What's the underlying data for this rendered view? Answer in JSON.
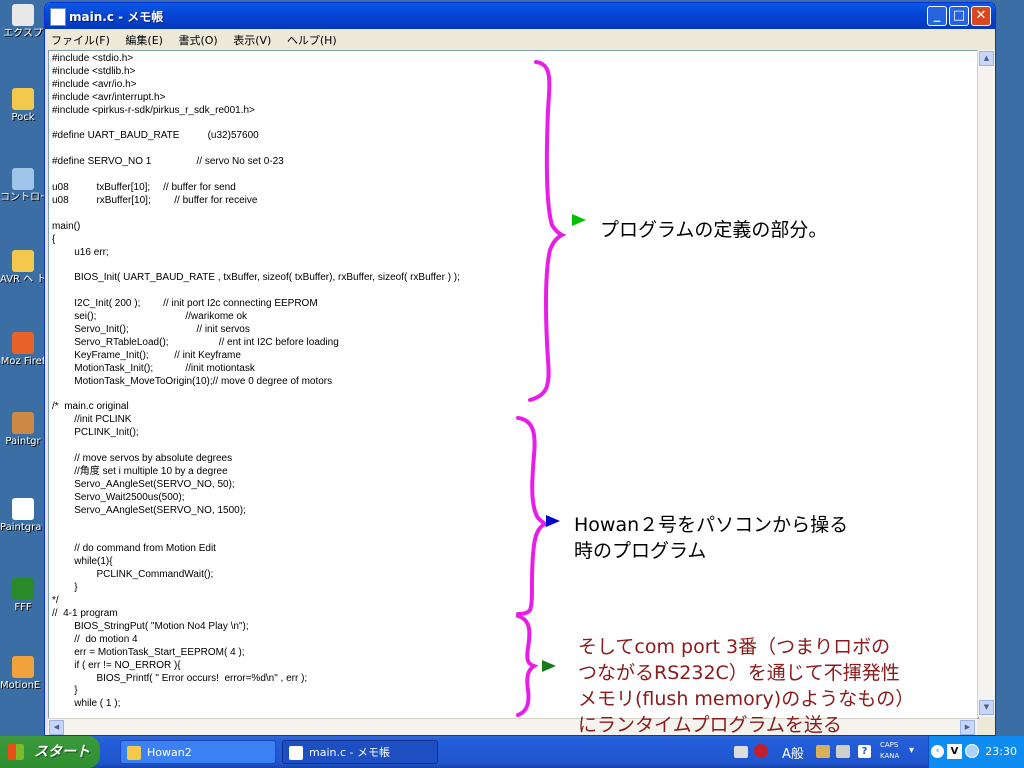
{
  "desktop": {
    "icons": [
      {
        "label": "エクスプ",
        "icon": "explorer-icon",
        "color": "#e8e8e8"
      },
      {
        "label": "Pock",
        "icon": "pocket-folder-icon",
        "color": "#f2c94c"
      },
      {
        "label": "コントロー ネ",
        "icon": "control-panel-icon",
        "color": "#9ec5e8"
      },
      {
        "label": "AVR ヘ トカ",
        "icon": "avr-folder-icon",
        "color": "#f2c94c"
      },
      {
        "label": "Moz Firef",
        "icon": "firefox-icon",
        "color": "#e8622a"
      },
      {
        "label": "Paintgr",
        "icon": "paint-icon",
        "color": "#cc8844"
      },
      {
        "label": "Paintgra マニュ",
        "icon": "manual-icon",
        "color": "#ffffff"
      },
      {
        "label": "FFF",
        "icon": "fff-icon",
        "color": "#2a8a2a"
      },
      {
        "label": "MotionE へのショ",
        "icon": "motion-editor-icon",
        "color": "#f2a23c"
      }
    ]
  },
  "window": {
    "title": "main.c - メモ帳",
    "controls": {
      "minimize": "_",
      "maximize": "□",
      "close": "✕"
    },
    "menu": [
      "ファイル(F)",
      "編集(E)",
      "書式(O)",
      "表示(V)",
      "ヘルプ(H)"
    ],
    "code": "#include <stdio.h>\n#include <stdlib.h>\n#include <avr/io.h>\n#include <avr/interrupt.h>\n#include <pirkus-r-sdk/pirkus_r_sdk_re001.h>\n\n#define UART_BAUD_RATE\t\t\t(u32)57600\n\n#define SERVO_NO 1\t\t\t\t// servo No set 0-23\n\nu08\t\t\ttxBuffer[10];\t\t// buffer for send\nu08\t\t\trxBuffer[10];\t\t// buffer for receive\n\nmain()\n{\n\t\tu16 err;\n\n\t\tBIOS_Init( UART_BAUD_RATE , txBuffer, sizeof( txBuffer), rxBuffer, sizeof( rxBuffer ) );\n\n\t\tI2C_Init( 200 );\t\t// init port I2c connecting EEPROM\n\t\tsei();\t\t\t\t\t\t\t\t//warikome ok\n\t\tServo_Init();\t\t\t\t\t\t// init servos\n\t\tServo_RTableLoad();\t\t\t\t\t// ent int I2C before loading\n\t\tKeyFrame_Init();\t\t\t// init Keyframe\n\t\tMotionTask_Init();\t\t\t//init motiontask\n\t\tMotionTask_MoveToOrigin(10);// move 0 degree of motors\n\n/*  main.c original\n\t\t//init PCLINK\n\t\tPCLINK_Init();\n\n\t\t// move servos by absolute degrees\n\t\t//角度 set i multiple 10 by a degree\n\t\tServo_AAngleSet(SERVO_NO, 50);\n\t\tServo_Wait2500us(500);\n\t\tServo_AAngleSet(SERVO_NO, 1500);\n\n\n\t\t// do command from Motion Edit\n\t\twhile(1){\n\t\t\t\tPCLINK_CommandWait();\n\t\t}\n*/\n//  4-1 program\n\t\tBIOS_StringPut( \"Motion No4 Play \\n\");\n\t\t//  do motion 4\n\t\terr = MotionTask_Start_EEPROM( 4 );\n\t\tif ( err != NO_ERROR ){\n\t\t\t\tBIOS_Printf( \" Error occurs!  error=%d\\n\" , err );\n\t\t}\n\t\twhile ( 1 );"
  },
  "annotations": {
    "definition": "プログラムの定義の部分。",
    "howan": [
      "Howan２号をパソコンから操る",
      "時のプログラム"
    ],
    "red": [
      "そしてcom port 3番（つまりロボの",
      "つながるRS232C）を通じて不揮発性",
      "メモリ(flush memory)のようなもの）",
      "にランタイムプログラムを送る"
    ],
    "colors": {
      "brace": "#e81ee8",
      "arrow_green": "#00c000",
      "arrow_blue": "#0000cc",
      "arrow_darkgreen": "#1a7a1a",
      "red_text": "#8b1a1a"
    }
  },
  "taskbar": {
    "start_label": "スタート",
    "buttons": [
      {
        "label": "Howan2",
        "icon": "folder-icon"
      },
      {
        "label": "main.c - メモ帳",
        "icon": "notepad-icon"
      }
    ],
    "ime": {
      "mode": "A般",
      "caps": "CAPS",
      "kana": "KANA"
    },
    "clock": "23:30"
  }
}
